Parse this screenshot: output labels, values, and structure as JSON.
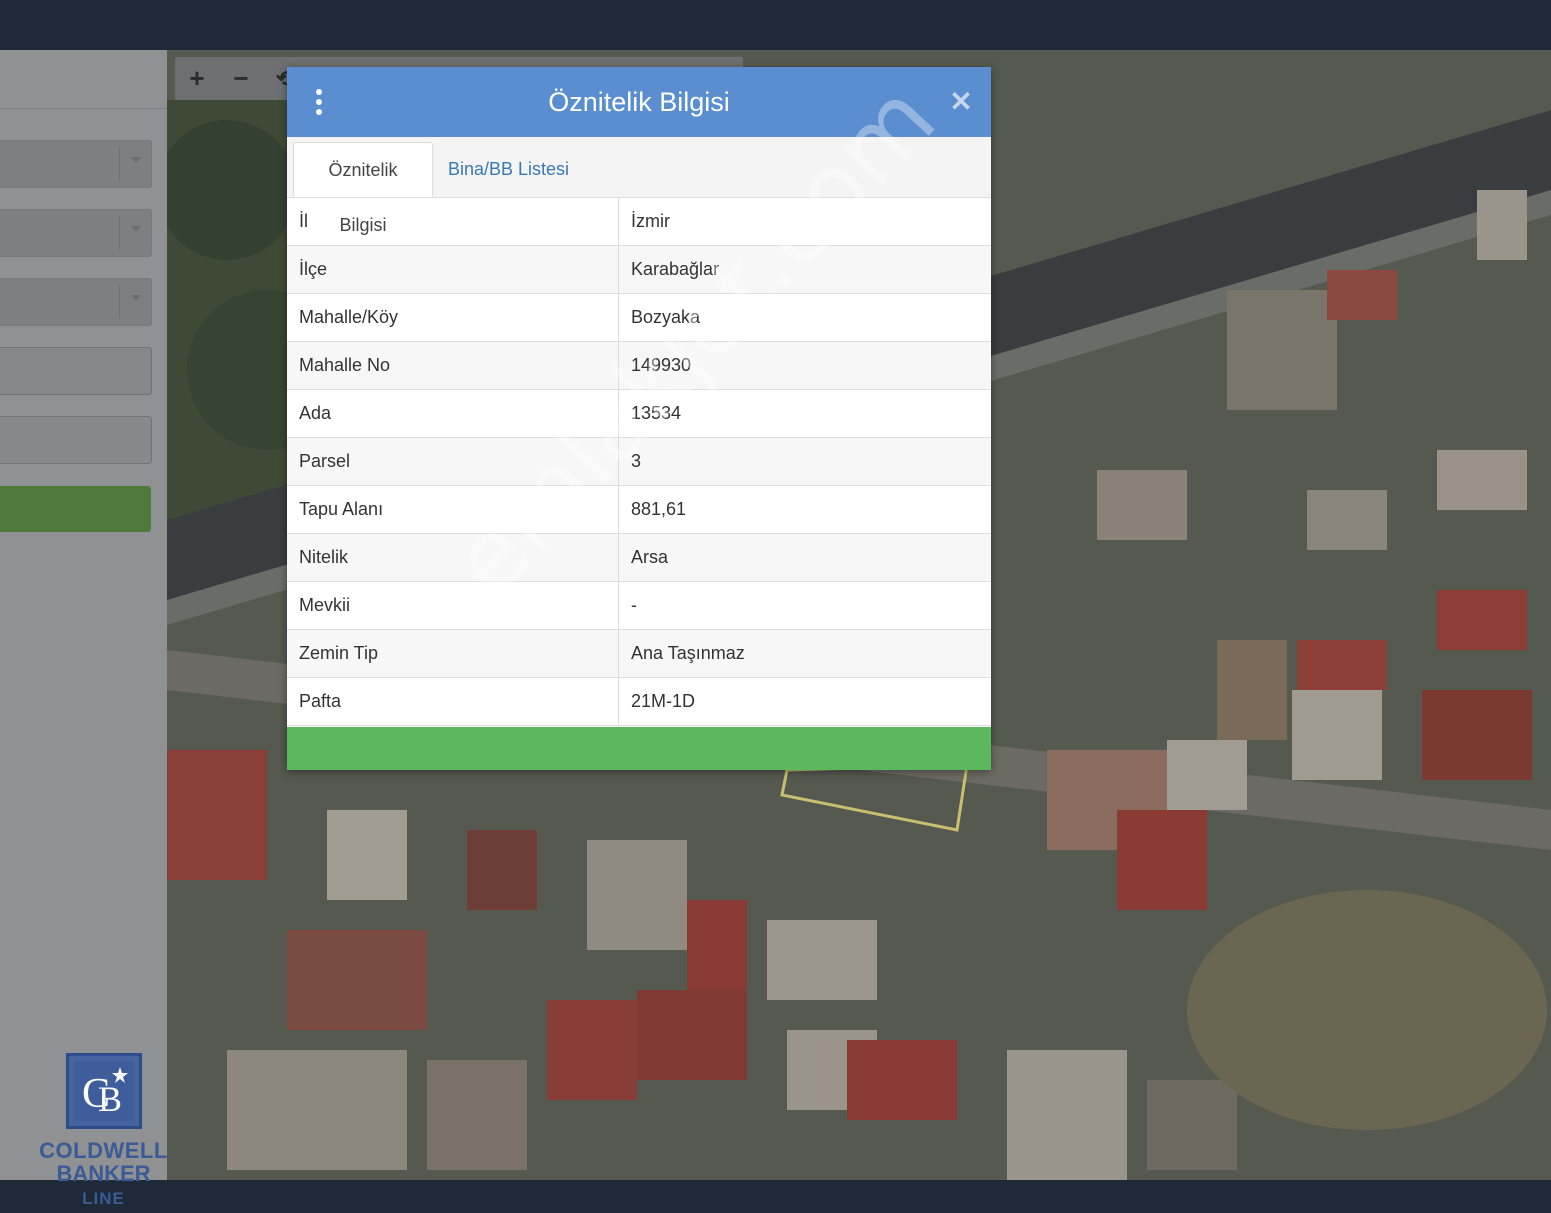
{
  "dialog": {
    "title": "Öznitelik Bilgisi",
    "menu_icon": "kebab-vertical-icon",
    "close_icon": "close-icon",
    "tabs": [
      {
        "label": "Öznitelik Bilgisi",
        "active": true
      },
      {
        "label": "Bina/BB Listesi",
        "active": false
      }
    ],
    "attributes": [
      {
        "key": "İl",
        "value": "İzmir"
      },
      {
        "key": "İlçe",
        "value": "Karabağlar"
      },
      {
        "key": "Mahalle/Köy",
        "value": "Bozyaka"
      },
      {
        "key": "Mahalle No",
        "value": "149930"
      },
      {
        "key": "Ada",
        "value": "13534"
      },
      {
        "key": "Parsel",
        "value": "3"
      },
      {
        "key": "Tapu Alanı",
        "value": "881,61"
      },
      {
        "key": "Nitelik",
        "value": "Arsa"
      },
      {
        "key": "Mevkii",
        "value": "-"
      },
      {
        "key": "Zemin Tip",
        "value": "Ana Taşınmaz"
      },
      {
        "key": "Pafta",
        "value": "21M-1D"
      }
    ],
    "header_color": "#5a8ed0",
    "footer_color": "#5cb85c"
  },
  "map_controls": {
    "zoom_in_icon": "plus-icon",
    "zoom_in_label": "+",
    "zoom_out_icon": "minus-icon",
    "zoom_out_label": "−",
    "rotate_icon": "refresh-icon"
  },
  "logo": {
    "line1": "COLDWELL",
    "line2": "BANKER",
    "line3": "LINE"
  },
  "watermark": "emlakjet.com"
}
